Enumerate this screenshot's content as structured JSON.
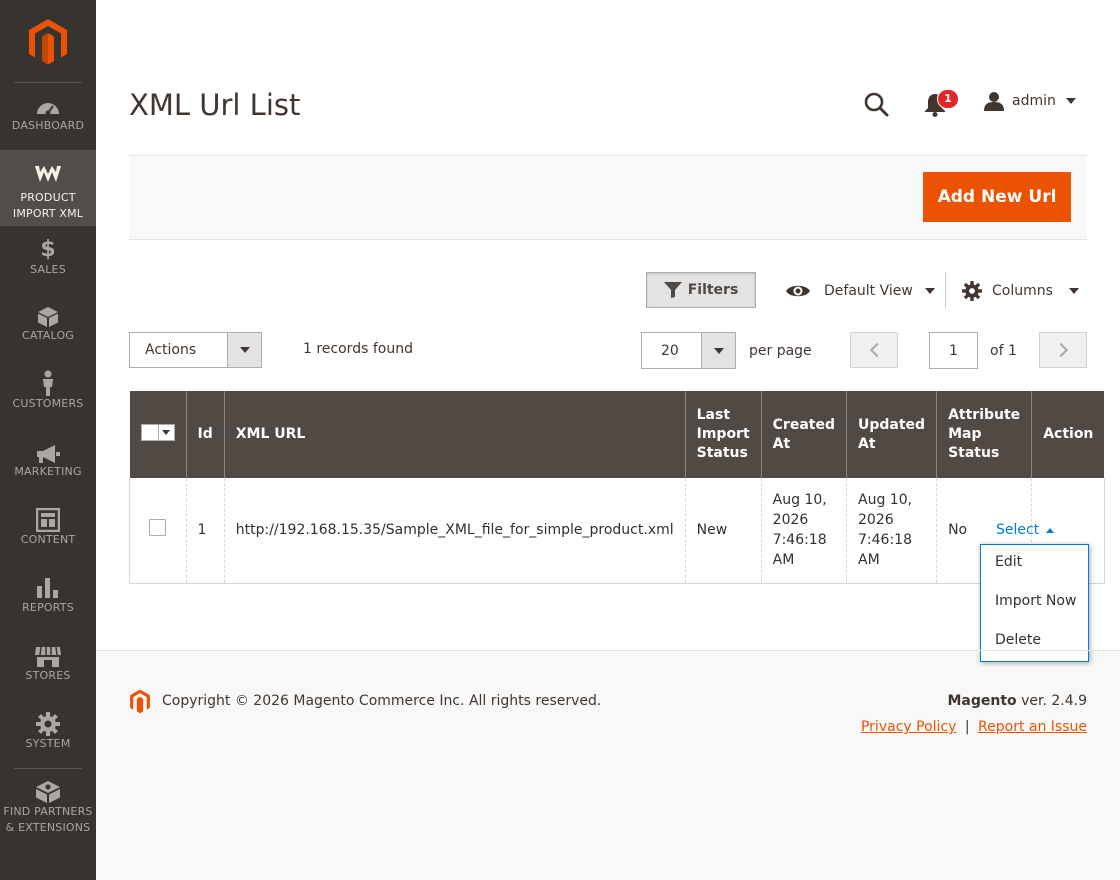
{
  "sidebar": {
    "items": [
      {
        "label": "DASHBOARD",
        "icon": "dashboard-icon"
      },
      {
        "label": "PRODUCT IMPORT XML",
        "icon": "product-import-xml-icon",
        "active": true
      },
      {
        "label": "SALES",
        "icon": "dollar-icon"
      },
      {
        "label": "CATALOG",
        "icon": "cube-icon"
      },
      {
        "label": "CUSTOMERS",
        "icon": "person-icon"
      },
      {
        "label": "MARKETING",
        "icon": "megaphone-icon"
      },
      {
        "label": "CONTENT",
        "icon": "layout-icon"
      },
      {
        "label": "REPORTS",
        "icon": "bar-chart-icon"
      },
      {
        "label": "STORES",
        "icon": "storefront-icon"
      },
      {
        "label": "SYSTEM",
        "icon": "gear-icon"
      },
      {
        "label": "FIND PARTNERS & EXTENSIONS",
        "icon": "extensions-icon"
      }
    ]
  },
  "header": {
    "title": "XML Url List",
    "notifications_count": "1",
    "username": "admin"
  },
  "toolbar": {
    "add_button": "Add New Url",
    "filters": "Filters",
    "default_view": "Default View",
    "columns": "Columns",
    "actions": "Actions",
    "records_found": "1 records found",
    "per_page_value": "20",
    "per_page_label": "per page",
    "current_page": "1",
    "of_pages": "of 1"
  },
  "grid": {
    "columns": [
      "Id",
      "XML URL",
      "Last Import Status",
      "Created At",
      "Updated At",
      "Attribute Map Status",
      "Action"
    ],
    "rows": [
      {
        "id": "1",
        "xml_url": "http://192.168.15.35/Sample_XML_file_for_simple_product.xml",
        "last_import_status": "New",
        "created_at": "Aug 10, 2026 7:46:18 AM",
        "updated_at": "Aug 10, 2026 7:46:18 AM",
        "attribute_map_status": "No",
        "action": "Select"
      }
    ],
    "action_menu": [
      "Edit",
      "Import Now",
      "Delete"
    ]
  },
  "footer": {
    "copyright": "Copyright © 2026 Magento Commerce Inc. All rights reserved.",
    "brand": "Magento",
    "version": "ver. 2.4.9",
    "privacy": "Privacy Policy",
    "separator": "|",
    "report": "Report an Issue"
  },
  "colors": {
    "accent": "#eb5202",
    "sidebar_bg": "#373330",
    "grid_header": "#514943",
    "link": "#007bdb"
  }
}
